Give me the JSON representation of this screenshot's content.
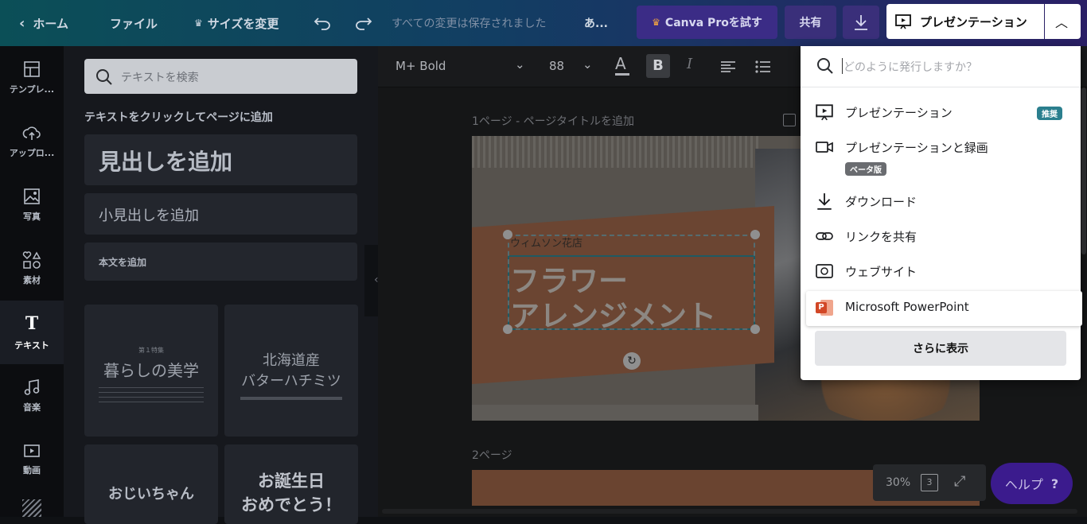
{
  "topbar": {
    "home_label": "ホーム",
    "file_label": "ファイル",
    "resize_label": "サイズを変更",
    "save_status": "すべての変更は保存されました",
    "title_ellipsis": "あ...",
    "pro_label": "Canva Proを試す",
    "share_label": "共有",
    "present_label": "プレゼンテーション"
  },
  "rail": {
    "items": [
      {
        "label": "テンプレ..."
      },
      {
        "label": "アップロ..."
      },
      {
        "label": "写真"
      },
      {
        "label": "素材"
      },
      {
        "label": "テキスト"
      },
      {
        "label": "音楽"
      },
      {
        "label": "動画"
      }
    ]
  },
  "panel": {
    "search_placeholder": "テキストを検索",
    "title": "テキストをクリックしてページに追加",
    "heading_btn": "見出しを追加",
    "subheading_btn": "小見出しを追加",
    "body_btn": "本文を追加",
    "tiles": [
      {
        "line1": "暮らしの美学",
        "line2": ""
      },
      {
        "line1": "北海道産",
        "line2": "バターハチミツ"
      },
      {
        "line1": "おじいちゃん",
        "line2": ""
      },
      {
        "line1": "お誕生日",
        "line2": "おめでとう！"
      }
    ]
  },
  "format_bar": {
    "font": "M+ Bold",
    "size": "88"
  },
  "canvas": {
    "page1_label": "1ページ - ページタイトルを追加",
    "page2_label": "2ページ",
    "slide_small_text": "ウィムソン花店",
    "slide_heading_1": "フラワー",
    "slide_heading_2": "アレンジメント"
  },
  "dropdown": {
    "search_placeholder": "どのように発行しますか？",
    "items": [
      {
        "label": "プレゼンテーション",
        "badge": "推奨"
      },
      {
        "label": "プレゼンテーションと録画",
        "badge": "ベータ版"
      },
      {
        "label": "ダウンロード"
      },
      {
        "label": "リンクを共有"
      },
      {
        "label": "ウェブサイト"
      },
      {
        "label": "Microsoft PowerPoint"
      }
    ],
    "more_label": "さらに表示"
  },
  "footer": {
    "zoom": "30%",
    "page_count": "3",
    "help_label": "ヘルプ",
    "help_mark": "?"
  },
  "colors": {
    "accent_purple": "#3b1b8d",
    "badge_teal": "#2b7f8e",
    "powerpoint_orange": "#d24726"
  }
}
